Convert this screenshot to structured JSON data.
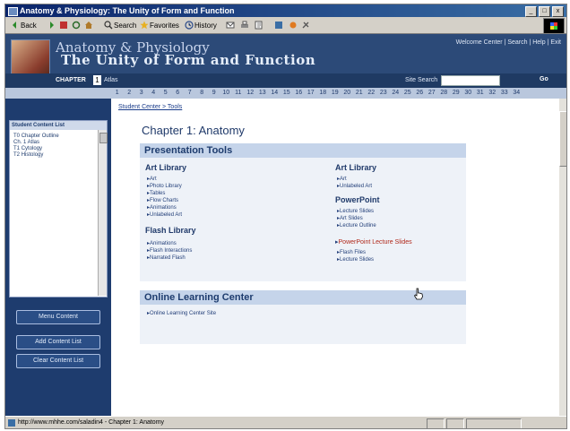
{
  "window": {
    "title": "Anatomy & Physiology: The Unity of Form and Function",
    "controls": [
      "_",
      "□",
      "x"
    ]
  },
  "toolbar": {
    "back_label": "Back",
    "search_label": "Search",
    "favorites_label": "Favorites",
    "history_label": "History"
  },
  "header": {
    "title_line1": "Anatomy & Physiology",
    "title_line2": "The Unity of Form and Function",
    "top_links": "Welcome Center | Search | Help | Exit",
    "chapter_label": "CHAPTER",
    "chapter_number": "1",
    "chapter_name": "Atlas",
    "search_label": "Site Search",
    "go_label": "Go"
  },
  "chapter_numbers": [
    "1",
    "2",
    "3",
    "4",
    "5",
    "6",
    "7",
    "8",
    "9",
    "10",
    "11",
    "12",
    "13",
    "14",
    "15",
    "16",
    "17",
    "18",
    "19",
    "20",
    "21",
    "22",
    "23",
    "24",
    "25",
    "26",
    "27",
    "28",
    "29",
    "30",
    "31",
    "32",
    "33",
    "34"
  ],
  "sidebar": {
    "panel_title": "Student Content List",
    "items": [
      {
        "num": "T0",
        "label": "Chapter Outline"
      },
      {
        "num": "",
        "label": "Ch. 1 Atlas"
      },
      {
        "num": "T1",
        "label": "Cytology"
      },
      {
        "num": "T2",
        "label": "Histology"
      }
    ],
    "buttons": [
      "Menu Content",
      "Add Content List",
      "Clear Content List"
    ]
  },
  "content": {
    "breadcrumb": "Student Center > Tools",
    "page_title": "Chapter 1: Anatomy",
    "presentation_tools": {
      "header": "Presentation Tools",
      "art_library": {
        "title": "Art Library",
        "links": [
          "Art",
          "Photo Library",
          "Tables",
          "Flow Charts",
          "Animations",
          "Unlabeled Art"
        ]
      },
      "flash_library": {
        "title": "Flash Library",
        "links": [
          "Animations",
          "Flash Interactions",
          "Narrated Flash"
        ]
      },
      "ppt_library": {
        "title": "Art Library",
        "links": [
          "Art",
          "Unlabeled Art"
        ]
      },
      "powerpoint": {
        "title": "PowerPoint",
        "links": [
          "Lecture Slides",
          "Art Slides",
          "Lecture Outline"
        ]
      },
      "highlight_link": "PowerPoint Lecture Slides",
      "extra_links": [
        "Flash Files",
        "Lecture Slides"
      ]
    },
    "online_learning": {
      "header": "Online Learning Center",
      "links": [
        "Online Learning Center Site"
      ]
    }
  },
  "statusbar": {
    "text": "http://www.mhhe.com/saladin4 - Chapter 1: Anatomy"
  }
}
